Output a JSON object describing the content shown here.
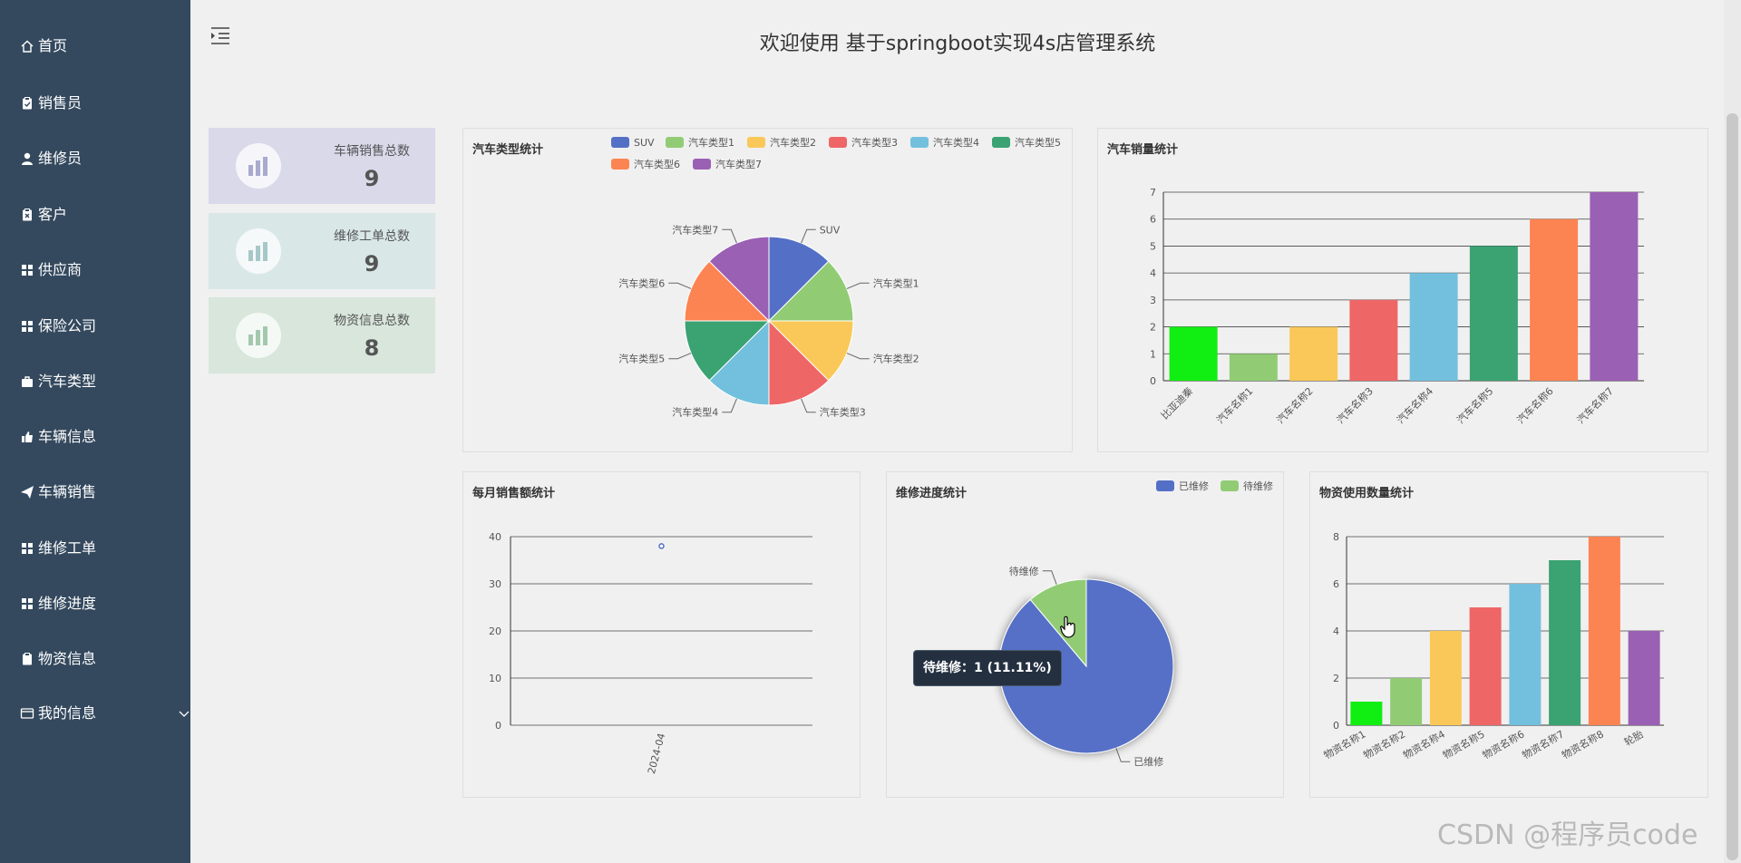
{
  "sidebar": {
    "items": [
      {
        "label": "首页",
        "icon": "home-icon"
      },
      {
        "label": "销售员",
        "icon": "clipboard-icon"
      },
      {
        "label": "维修员",
        "icon": "user-icon"
      },
      {
        "label": "客户",
        "icon": "clipboard-icon"
      },
      {
        "label": "供应商",
        "icon": "grid-icon"
      },
      {
        "label": "保险公司",
        "icon": "grid-icon"
      },
      {
        "label": "汽车类型",
        "icon": "briefcase-icon"
      },
      {
        "label": "车辆信息",
        "icon": "thumbs-up-icon"
      },
      {
        "label": "车辆销售",
        "icon": "send-icon"
      },
      {
        "label": "维修工单",
        "icon": "grid-icon"
      },
      {
        "label": "维修进度",
        "icon": "grid-icon"
      },
      {
        "label": "物资信息",
        "icon": "clipboard-icon"
      },
      {
        "label": "我的信息",
        "icon": "card-icon"
      }
    ]
  },
  "header": {
    "title": "欢迎使用 基于springboot实现4s店管理系统"
  },
  "stats": [
    {
      "label": "车辆销售总数",
      "value": "9",
      "color": "#d9d9ea"
    },
    {
      "label": "维修工单总数",
      "value": "9",
      "color": "#d9e7e7"
    },
    {
      "label": "物资信息总数",
      "value": "8",
      "color": "#d8e6dc"
    }
  ],
  "tooltip": {
    "text": "待维修：1 (11.11%)"
  },
  "watermark": "CSDN @程序员code",
  "colors": {
    "sidebar": "#34495e",
    "palette": [
      "#5470c6",
      "#91cc75",
      "#fac858",
      "#ee6666",
      "#73c0de",
      "#3ba272",
      "#fc8452",
      "#9a60b4"
    ],
    "green_bar": "#11ee11"
  },
  "chart_data": [
    {
      "type": "pie",
      "title": "汽车类型统计",
      "categories": [
        "SUV",
        "汽车类型1",
        "汽车类型2",
        "汽车类型3",
        "汽车类型4",
        "汽车类型5",
        "汽车类型6",
        "汽车类型7"
      ],
      "values": [
        1,
        1,
        1,
        1,
        1,
        1,
        1,
        1
      ],
      "legend": "top-right"
    },
    {
      "type": "bar",
      "title": "汽车销量统计",
      "categories": [
        "比亚迪秦",
        "汽车名称1",
        "汽车名称2",
        "汽车名称3",
        "汽车名称4",
        "汽车名称5",
        "汽车名称6",
        "汽车名称7"
      ],
      "values": [
        2,
        1,
        2,
        3,
        4,
        5,
        6,
        7
      ],
      "ylim": [
        0,
        7
      ],
      "yticks": [
        "0",
        "1",
        "2",
        "3",
        "4",
        "5",
        "6",
        "7"
      ],
      "grid": true
    },
    {
      "type": "line",
      "title": "每月销售额统计",
      "x": [
        "2024-04"
      ],
      "values": [
        38
      ],
      "ylim": [
        0,
        40
      ],
      "yticks": [
        "0",
        "10",
        "20",
        "30",
        "40"
      ],
      "grid": true
    },
    {
      "type": "pie",
      "title": "维修进度统计",
      "categories": [
        "已维修",
        "待维修"
      ],
      "values": [
        8,
        1
      ],
      "legend": "top-right"
    },
    {
      "type": "bar",
      "title": "物资使用数量统计",
      "categories": [
        "物资名称1",
        "物资名称2",
        "物资名称4",
        "物资名称5",
        "物资名称6",
        "物资名称7",
        "物资名称8",
        "轮胎"
      ],
      "values": [
        1,
        2,
        4,
        5,
        6,
        7,
        8,
        4
      ],
      "ylim": [
        0,
        8
      ],
      "yticks": [
        "0",
        "2",
        "4",
        "6",
        "8"
      ],
      "grid": true
    }
  ]
}
